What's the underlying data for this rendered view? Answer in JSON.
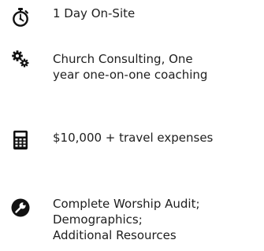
{
  "features": {
    "items": [
      {
        "icon": "stopwatch-icon",
        "text": "1 Day On-Site"
      },
      {
        "icon": "gears-icon",
        "text": "Church Consulting, One\nyear one-on-one coaching"
      },
      {
        "icon": "calculator-icon",
        "text": "$10,000 + travel expenses"
      },
      {
        "icon": "wrench-icon",
        "text": "Complete Worship Audit;\nDemographics;\nAdditional Resources"
      }
    ]
  },
  "colors": {
    "icon": "#111111",
    "text": "#1e1e1e",
    "background": "#ffffff"
  }
}
